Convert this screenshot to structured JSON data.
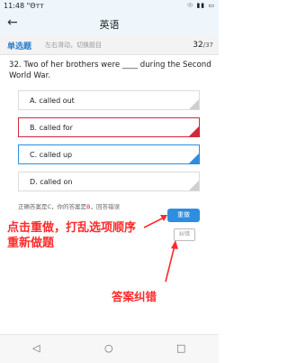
{
  "status_bar": {
    "time": "11:48 \"Θтт",
    "icons": "☉ ▮▮ ▭"
  },
  "app_bar": {
    "back_icon": "back-arrow-icon",
    "title": "英语"
  },
  "question_bar": {
    "type": "单选题",
    "hint": "左右滑动，切换题目",
    "current": "32",
    "total": "/37"
  },
  "question": {
    "text": "32. Two of her brothers were ____ during the Second World War."
  },
  "options": [
    {
      "label": "A. called out",
      "state": "plain"
    },
    {
      "label": "B. called for",
      "state": "wrong"
    },
    {
      "label": "C. called up",
      "state": "right"
    },
    {
      "label": "D. called on",
      "state": "plain"
    }
  ],
  "answer_note": {
    "prefix": "正确答案是C，你的答案是",
    "mine": "B",
    "suffix": "，回答错误"
  },
  "buttons": {
    "redo": "重做",
    "report": "纠错"
  },
  "annotations": {
    "redo_line1": "点击重做，打乱选项顺序",
    "redo_line2": "重新做题",
    "report": "答案纠错"
  },
  "nav": {
    "back": "◁",
    "home": "○",
    "recent": "□"
  },
  "colors": {
    "accent": "#2f8de0",
    "wrong": "#d3283a",
    "annotation": "#ff2a2a"
  }
}
